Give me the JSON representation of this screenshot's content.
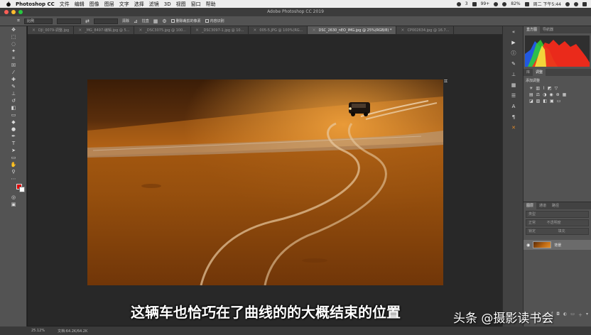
{
  "menubar": {
    "app_name": "Photoshop CC",
    "items": [
      "文件",
      "编辑",
      "图像",
      "图层",
      "文字",
      "选择",
      "滤镜",
      "3D",
      "视图",
      "窗口",
      "帮助"
    ],
    "status": {
      "notifications": "3",
      "count": "99+",
      "battery": "82%",
      "datetime": "周二 下午5:44"
    }
  },
  "window": {
    "title": "Adobe Photoshop CC 2019"
  },
  "options_bar": {
    "ratio": "比例",
    "clear_label": "清除",
    "straighten_label": "拉直",
    "delete_cropped_label": "删除裁剪的像素",
    "content_aware_label": "内容识别"
  },
  "tabs": [
    {
      "label": "DJI_0079-调整.jpg",
      "active": false
    },
    {
      "label": "_MG_8497-编辑.jpg @ 5...",
      "active": false
    },
    {
      "label": "_DSC3075.jpg @ 100...",
      "active": false
    },
    {
      "label": "_DSC3097-1.jpg @ 10...",
      "active": false
    },
    {
      "label": "005-5.JPG @ 100%(RG...",
      "active": false
    },
    {
      "label": "DSC_2630_nEO_IMG.jpg @ 25%(RGB/8) *",
      "active": true
    },
    {
      "label": "CP002634.jpg @ 16.7...",
      "active": false
    }
  ],
  "panels": {
    "histogram_tabs": [
      "直方图",
      "导航器"
    ],
    "adjust_tabs": [
      "库",
      "调整"
    ],
    "adjust_title": "添加调整",
    "layer_tabs": [
      "图层",
      "通道",
      "路径"
    ],
    "layer_kind": "类型",
    "layer_mode": "正常",
    "layer_opacity": "不透明度",
    "layer_lock": "锁定",
    "layer_fill": "填充",
    "layer_name": "背景"
  },
  "status_bar": {
    "zoom": "25.12%",
    "doc": "文档:64.2K/64.2K"
  },
  "overlay": {
    "subtitle": "这辆车也恰巧在了曲线的的大概结束的位置",
    "watermark": "头条 @摄影读书会"
  },
  "colors": {
    "foreground": "#e00000",
    "background": "#ffffff",
    "accent": "#e08a2a"
  }
}
